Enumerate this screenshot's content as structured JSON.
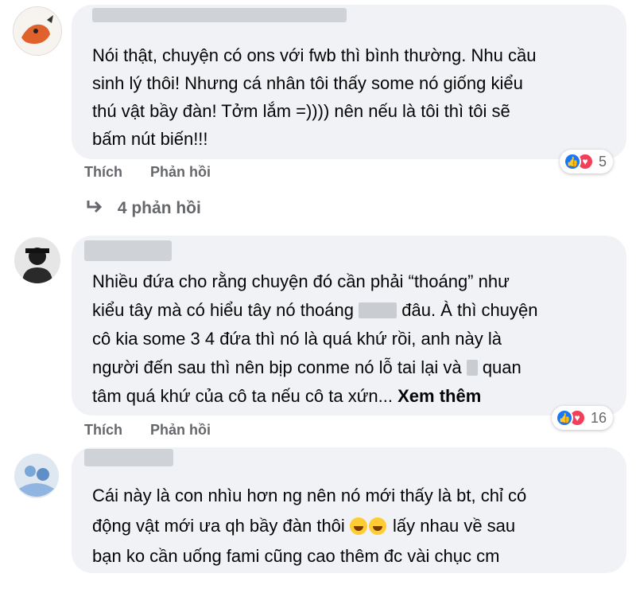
{
  "comments": [
    {
      "lines": [
        "Nói thật, chuyện có ons với fwb thì bình thường. Nhu cầu",
        "sinh lý thôi! Nhưng cá nhân tôi thấy some nó giống kiểu",
        "thú vật bầy đàn! Tởm lắm =)))) nên nếu là tôi thì tôi sẽ",
        "bấm nút biến!!!"
      ],
      "like_label": "Thích",
      "reply_label": "Phản hồi",
      "reaction_count": "5",
      "replies_label": "4 phản hồi"
    },
    {
      "line1": "Nhiều đứa cho rằng chuyện đó cần phải “thoáng” như",
      "line2a": "kiểu tây mà có hiểu tây nó thoáng",
      "line2b": "đâu. À thì chuyện",
      "line3": "cô kia some 3 4 đứa thì nó là quá khứ rồi, anh này là",
      "line4a": "người đến sau thì nên bịp conme nó lỗ tai lại và",
      "line4b": "quan",
      "line5": "tâm quá khứ của cô ta nếu cô ta xứn...",
      "see_more": "Xem thêm",
      "like_label": "Thích",
      "reply_label": "Phản hồi",
      "reaction_count": "16"
    },
    {
      "line1": "Cái này là con nhìu hơn ng nên nó mới thấy là bt, chỉ có",
      "line2a": "động vật mới ưa qh bầy đàn thôi",
      "line2b": "lấy nhau về sau",
      "line3": "bạn ko cần uống fami cũng cao thêm đc vài chục cm"
    }
  ],
  "icons": {
    "reply_arrow": "reply-arrow-icon",
    "like": "like-reaction-icon",
    "love": "love-reaction-icon",
    "emoji_rofl": "rolling-laughing-emoji",
    "emoji_grin": "grinning-sweat-emoji"
  }
}
